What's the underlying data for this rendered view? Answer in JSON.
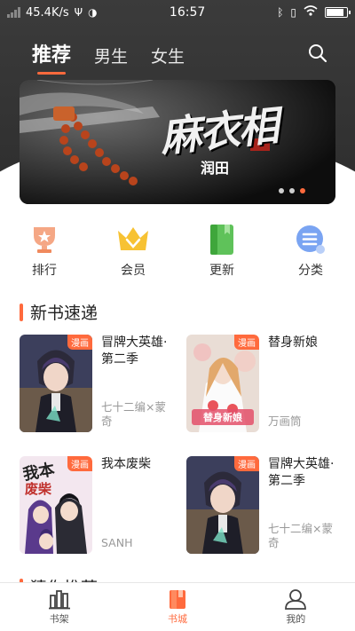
{
  "status_bar": {
    "speed": "45.4K/s",
    "time": "16:57"
  },
  "tabs": [
    {
      "label": "推荐",
      "active": true
    },
    {
      "label": "男生",
      "active": false
    },
    {
      "label": "女生",
      "active": false
    }
  ],
  "banner": {
    "title_art": "麻衣相",
    "subtitle": "润田",
    "dots": 3,
    "active_dot": 3
  },
  "categories": [
    {
      "label": "排行",
      "icon": "trophy-icon"
    },
    {
      "label": "会员",
      "icon": "crown-icon"
    },
    {
      "label": "更新",
      "icon": "book-icon"
    },
    {
      "label": "分类",
      "icon": "category-icon"
    }
  ],
  "section": {
    "title": "新书速递"
  },
  "books": [
    {
      "title": "冒牌大英雄·第二季",
      "author": "七十二编×蒙奇",
      "tag": "漫画"
    },
    {
      "title": "替身新娘",
      "author": "万画筒",
      "tag": "漫画"
    },
    {
      "title": "我本废柴",
      "author": "SANH",
      "tag": "漫画"
    },
    {
      "title": "冒牌大英雄·第二季",
      "author": "七十二编×蒙奇",
      "tag": "漫画"
    }
  ],
  "next_section": {
    "title": "猜你推荐"
  },
  "bottom_nav": [
    {
      "label": "书架",
      "icon": "bookshelf-icon",
      "active": false
    },
    {
      "label": "书城",
      "icon": "bookstore-icon",
      "active": true
    },
    {
      "label": "我的",
      "icon": "profile-icon",
      "active": false
    }
  ],
  "colors": {
    "accent": "#ff6a3d",
    "header_bg": "#333333",
    "muted_text": "#999999"
  }
}
